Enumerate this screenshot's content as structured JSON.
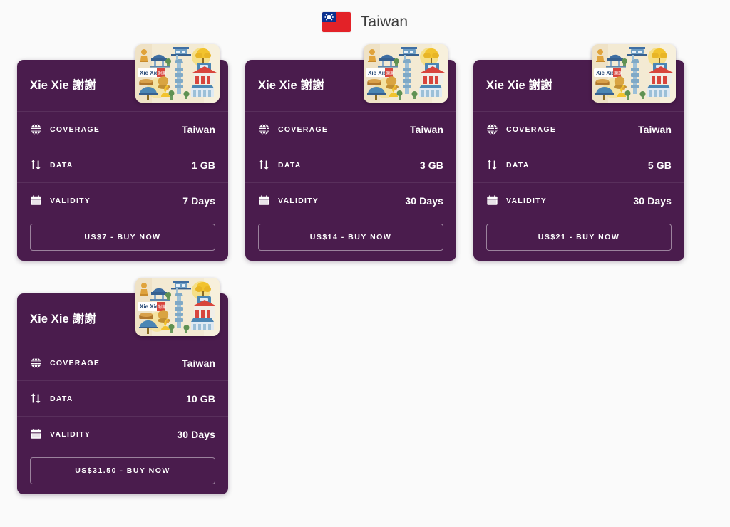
{
  "header": {
    "flag_icon": "taiwan-flag-icon",
    "title": "Taiwan",
    "flag_colors": {
      "red": "#e32228",
      "blue": "#0b318f",
      "white": "#ffffff"
    }
  },
  "theme": {
    "page_background": "#fafafa",
    "card_background": "#4a1c4d",
    "text_primary": "#ffffff",
    "title_color": "#3c3c3c",
    "divider": "rgba(255,255,255,0.085)",
    "button_border": "rgba(255,255,255,0.45)"
  },
  "labels": {
    "coverage": "COVERAGE",
    "data": "DATA",
    "validity": "VALIDITY"
  },
  "icons": {
    "coverage": "globe-icon",
    "data": "up-down-arrows-icon",
    "validity": "calendar-icon",
    "art": "taiwan-landmarks-illustration"
  },
  "art": {
    "badge_text_latin": "Xie Xie",
    "badge_text_cjk": "謝謝"
  },
  "plans": [
    {
      "title": "Xie Xie 謝謝",
      "coverage": "Taiwan",
      "data": "1 GB",
      "validity": "7 Days",
      "buy_label": "US$7 - BUY NOW"
    },
    {
      "title": "Xie Xie 謝謝",
      "coverage": "Taiwan",
      "data": "3 GB",
      "validity": "30 Days",
      "buy_label": "US$14 - BUY NOW"
    },
    {
      "title": "Xie Xie 謝謝",
      "coverage": "Taiwan",
      "data": "5 GB",
      "validity": "30 Days",
      "buy_label": "US$21 - BUY NOW"
    },
    {
      "title": "Xie Xie 謝謝",
      "coverage": "Taiwan",
      "data": "10 GB",
      "validity": "30 Days",
      "buy_label": "US$31.50 - BUY NOW"
    }
  ]
}
